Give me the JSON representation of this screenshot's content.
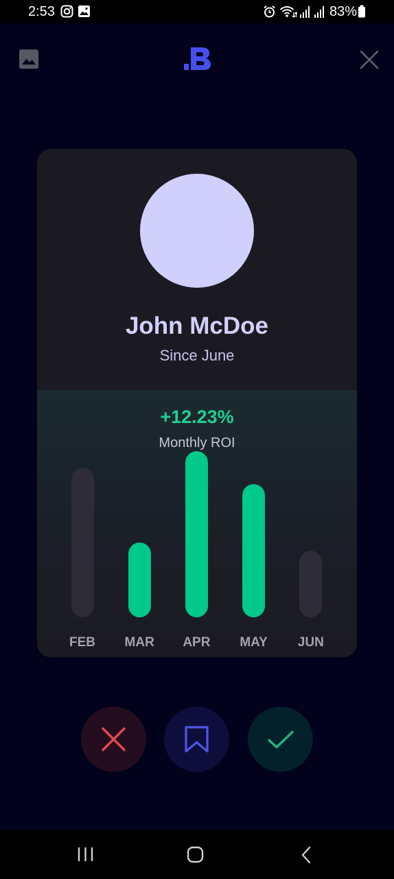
{
  "status_bar": {
    "time": "2:53",
    "battery": "83%",
    "icons": [
      "instagram-icon",
      "gallery-icon",
      "alarm-icon",
      "wifi-icon",
      "signal-icon",
      "signal-icon",
      "battery-icon"
    ]
  },
  "topbar": {
    "left_icon": "image-icon",
    "logo_icon": "brand-logo",
    "right_icon": "close-icon"
  },
  "profile": {
    "name": "John McDoe",
    "since": "Since June"
  },
  "stats": {
    "roi": "+12.23%",
    "roi_label": "Monthly ROI"
  },
  "colors": {
    "background": "#02021c",
    "card": "#1b1a22",
    "accent_green": "#00c98a",
    "inactive_bar": "#2d2c37",
    "reject": "#e2474e",
    "bookmark": "#4f54e6",
    "accept": "#1fb57f"
  },
  "chart_data": {
    "type": "bar",
    "categories": [
      "FEB",
      "MAR",
      "APR",
      "MAY",
      "JUN"
    ],
    "values": [
      0.9,
      0.45,
      1.0,
      0.8,
      0.4
    ],
    "highlighted": [
      false,
      true,
      true,
      true,
      false
    ],
    "ylim": [
      0,
      1
    ]
  },
  "actions": {
    "reject_icon": "close-icon",
    "bookmark_icon": "bookmark-icon",
    "accept_icon": "check-icon"
  },
  "navbar": {
    "icons": [
      "recent-apps-icon",
      "home-icon",
      "back-icon"
    ]
  }
}
